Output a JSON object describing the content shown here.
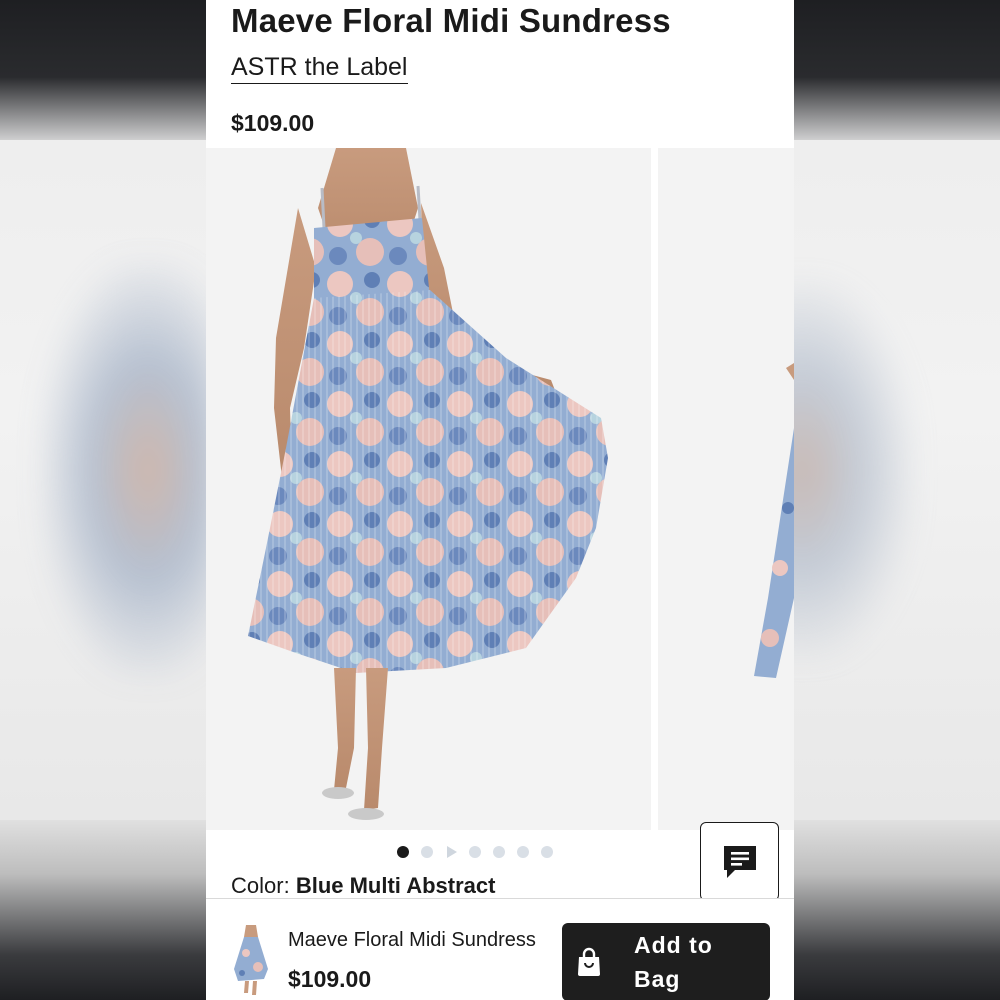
{
  "product": {
    "title": "Maeve Floral Midi Sundress",
    "brand": "ASTR the Label",
    "price": "$109.00"
  },
  "carousel": {
    "slide_count": 7,
    "active_index": 0,
    "video_slide_index": 2
  },
  "color": {
    "label": "Color:",
    "value": "Blue Multi Abstract"
  },
  "chat": {
    "icon": "chat-icon"
  },
  "sticky_bar": {
    "name": "Maeve Floral Midi Sundress",
    "price": "$109.00",
    "add_to_bag_label": "Add to Bag",
    "icon": "shopping-bag-icon"
  },
  "colors": {
    "text": "#1a1a1a",
    "button": "#1e1e1e",
    "dot_inactive": "#d9dfe6",
    "dress_blue": "#7f9cc6",
    "dress_pink": "#e9c4c0"
  }
}
